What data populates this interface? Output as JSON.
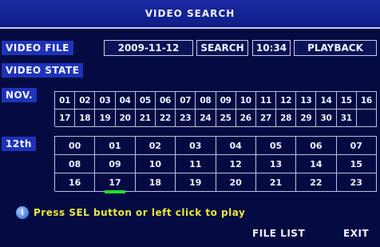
{
  "title": "VIDEO SEARCH",
  "video_file": {
    "label": "VIDEO FILE",
    "date": "2009-11-12",
    "search_label": "SEARCH",
    "time": "10:34",
    "playback_label": "PLAYBACK"
  },
  "video_state": {
    "label": "VIDEO STATE"
  },
  "calendar": {
    "month": "NOV.",
    "days": [
      "01",
      "02",
      "03",
      "04",
      "05",
      "06",
      "07",
      "08",
      "09",
      "10",
      "11",
      "12",
      "13",
      "14",
      "15",
      "16",
      "17",
      "18",
      "19",
      "20",
      "21",
      "22",
      "23",
      "24",
      "25",
      "26",
      "27",
      "28",
      "29",
      "30",
      "31"
    ]
  },
  "hours": {
    "day_label": "12th",
    "values": [
      "00",
      "01",
      "02",
      "03",
      "04",
      "05",
      "06",
      "07",
      "08",
      "09",
      "10",
      "11",
      "12",
      "13",
      "14",
      "15",
      "16",
      "17",
      "18",
      "19",
      "20",
      "21",
      "22",
      "23"
    ],
    "selected": "17"
  },
  "hint": "Press SEL button or left click to play",
  "buttons": {
    "file_list": "FILE LIST",
    "exit": "EXIT"
  },
  "colors": {
    "background": "#050b42",
    "title_bar": "#1b2aa4",
    "hint_text": "#e8e83a",
    "selection_marker": "#22dd33",
    "info_icon": "info-icon"
  }
}
